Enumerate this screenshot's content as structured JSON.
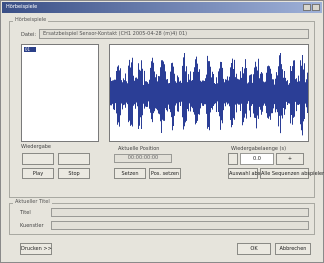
{
  "window": {
    "title": "Hörbeispiele"
  },
  "group_top": {
    "label": "Hörbeispiele"
  },
  "datei": {
    "label": "Datei:",
    "value": "Ersatzbeispiel   Sensor-Kontakt   (CH1 2005-04-28 (m)4) 01)"
  },
  "list": {
    "selected": "01"
  },
  "loop": {
    "label": "Wiedergabe",
    "buttons": [
      "Play",
      "Stop"
    ]
  },
  "position": {
    "label": "Aktuelle Position",
    "value": "00:00:00:00",
    "buttons": [
      "Setzen",
      "Pos. setzen"
    ]
  },
  "right": {
    "label": "Wiedergabelaenge (s)",
    "value": "0.0",
    "buttons": [
      "Auswahl abspielen",
      "Alle Sequenzen abspielen"
    ]
  },
  "group_bottom": {
    "label": "Aktueller Titel",
    "title_label": "Titel",
    "artist_label": "Kuenstler"
  },
  "footer": {
    "left_button": "Drucken >>",
    "ok_button": "OK",
    "cancel_button": "Abbrechen"
  },
  "colors": {
    "accent": "#3a4f86",
    "wave": "#2b3e96"
  }
}
